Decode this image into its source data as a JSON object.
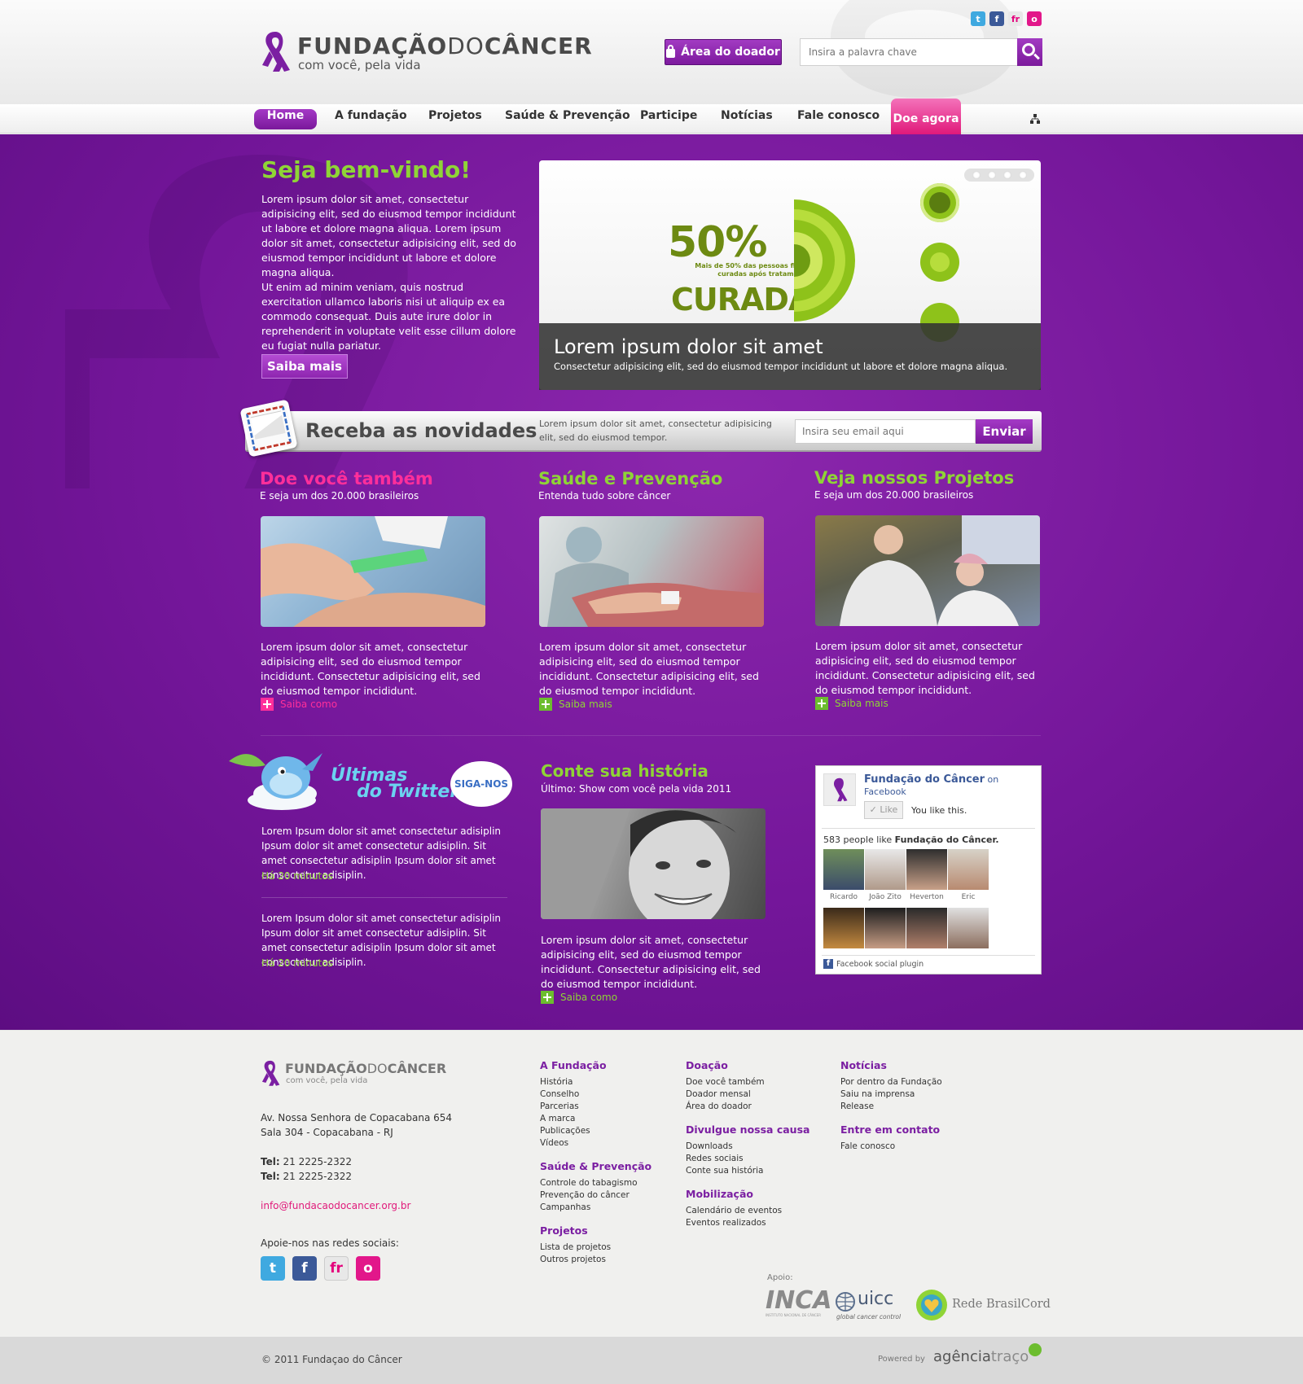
{
  "header": {
    "logo_main": "FUNDAÇÃO",
    "logo_do": "DO",
    "logo_end": "CÂNCER",
    "tagline": "com você, pela vida",
    "social": [
      "t",
      "f",
      "fr",
      "o"
    ],
    "donor_area": "Área do doador",
    "search_placeholder": "Insira a palavra chave"
  },
  "nav": {
    "items": [
      "Home",
      "A fundação",
      "Projetos",
      "Saúde & Prevenção",
      "Participe",
      "Notícias",
      "Fale conosco"
    ],
    "donate": "Doe agora"
  },
  "welcome": {
    "title": "Seja bem-vindo!",
    "p1": "Lorem ipsum dolor sit amet, consectetur adipisicing elit, sed do eiusmod tempor incididunt ut labore et dolore magna aliqua. Lorem ipsum dolor sit amet, consectetur adipisicing elit, sed do eiusmod tempor incididunt ut labore et dolore magna aliqua.",
    "p2": "Ut enim ad minim veniam, quis nostrud exercitation ullamco laboris nisi ut aliquip ex ea commodo consequat. Duis aute irure dolor in reprehenderit in voluptate velit esse cillum dolore eu fugiat nulla pariatur.",
    "button": "Saiba mais"
  },
  "slider": {
    "stat": "50%",
    "stat_sub": "Mais de 50% das pessoas ficam curadas após tratamento",
    "stat_word": "CURADAS",
    "caption_title": "Lorem ipsum dolor sit amet",
    "caption_text": "Consectetur adipisicing elit, sed do eiusmod tempor incididunt ut labore et dolore magna aliqua.",
    "slide_count": 4
  },
  "newsletter": {
    "title": "Receba as novidades",
    "text": "Lorem ipsum dolor sit amet, consectetur adipisicing elit, sed do eiusmod tempor.",
    "placeholder": "Insira seu email aqui",
    "button": "Enviar"
  },
  "columns": [
    {
      "title": "Doe você também",
      "subtitle": "E seja um dos 20.000 brasileiros",
      "text": "Lorem ipsum dolor sit amet, consectetur adipisicing elit, sed do eiusmod tempor incididunt. Consectetur adipisicing elit, sed do eiusmod tempor incididunt.",
      "link": "Saiba como"
    },
    {
      "title": "Saúde e Prevenção",
      "subtitle": "Entenda tudo sobre câncer",
      "text": "Lorem ipsum dolor sit amet, consectetur adipisicing elit, sed do eiusmod tempor incididunt. Consectetur adipisicing elit, sed do eiusmod tempor incididunt.",
      "link": "Saiba mais"
    },
    {
      "title": "Veja nossos Projetos",
      "subtitle": "E seja um dos 20.000 brasileiros",
      "text": "Lorem ipsum dolor sit amet, consectetur adipisicing elit, sed do eiusmod tempor incididunt. Consectetur adipisicing elit, sed do eiusmod tempor incididunt.",
      "link": "Saiba mais"
    }
  ],
  "twitter": {
    "title_line1": "Últimas",
    "title_line2": "do Twitter",
    "follow": "SIGA-NOS",
    "tweets": [
      {
        "text": "Lorem Ipsum dolor sit amet consectetur adisiplin Ipsum dolor sit amet consectetur adisiplin. Sit amet consectetur adisiplin Ipsum dolor sit amet consectetur adisiplin.",
        "time": "Há 20 minutos"
      },
      {
        "text": "Lorem Ipsum dolor sit amet consectetur adisiplin Ipsum dolor sit amet consectetur adisiplin. Sit amet consectetur adisiplin Ipsum dolor sit amet consectetur adisiplin.",
        "time": "Há 20 minutos"
      }
    ]
  },
  "story": {
    "title": "Conte sua história",
    "subtitle": "Último: Show com você pela vida 2011",
    "text": "Lorem ipsum dolor sit amet, consectetur adipisicing elit, sed do eiusmod tempor incididunt. Consectetur adipisicing elit, sed do eiusmod tempor incididunt.",
    "link": "Saiba como"
  },
  "facebook": {
    "page_name": "Fundação do Câncer",
    "on": "on",
    "network": "Facebook",
    "like_button": "Like",
    "you_like": "You like this.",
    "count_text": "583 people like",
    "count_page": "Fundação do Câncer.",
    "friends": [
      "Ricardo",
      "João Zito",
      "Heverton",
      "Eric"
    ],
    "plugin": "Facebook social plugin"
  },
  "footer": {
    "address1": "Av. Nossa Senhora de Copacabana 654",
    "address2": "Sala 304 - Copacabana - RJ",
    "tel_label": "Tel:",
    "tel1": "21 2225-2322",
    "tel2": "21 2225-2322",
    "email": "info@fundacaodocancer.org.br",
    "social_label": "Apoie-nos nas redes sociais:",
    "col1": [
      {
        "title": "A Fundação",
        "links": [
          "História",
          "Conselho",
          "Parcerias",
          "A marca",
          "Publicações",
          "Vídeos"
        ]
      },
      {
        "title": "Saúde & Prevenção",
        "links": [
          "Controle do tabagismo",
          "Prevenção do câncer",
          "Campanhas"
        ]
      },
      {
        "title": "Projetos",
        "links": [
          "Lista de projetos",
          "Outros projetos"
        ]
      }
    ],
    "col2": [
      {
        "title": "Doação",
        "links": [
          "Doe você também",
          "Doador mensal",
          "Área do doador"
        ]
      },
      {
        "title": "Divulgue nossa causa",
        "links": [
          "Downloads",
          "Redes sociais",
          "Conte sua história"
        ]
      },
      {
        "title": "Mobilização",
        "links": [
          "Calendário de eventos",
          "Eventos realizados"
        ]
      }
    ],
    "col3": [
      {
        "title": "Notícias",
        "links": [
          "Por dentro da Fundação",
          "Saiu na imprensa",
          "Release"
        ]
      },
      {
        "title": "Entre em contato",
        "links": [
          "Fale conosco"
        ]
      }
    ],
    "support_label": "Apoio:",
    "sponsors": [
      "INCA",
      "INSTITUTO NACIONAL DE CÂNCER",
      "uicc",
      "global cancer control",
      "Rede BrasilCord"
    ],
    "copyright": "© 2011 Fundaçao do Câncer",
    "powered": "Powered by",
    "agency_a": "agência",
    "agency_b": "traço"
  },
  "colors": {
    "purple": "#7a189b",
    "pink": "#ff2f9a",
    "green": "#8fd436"
  }
}
